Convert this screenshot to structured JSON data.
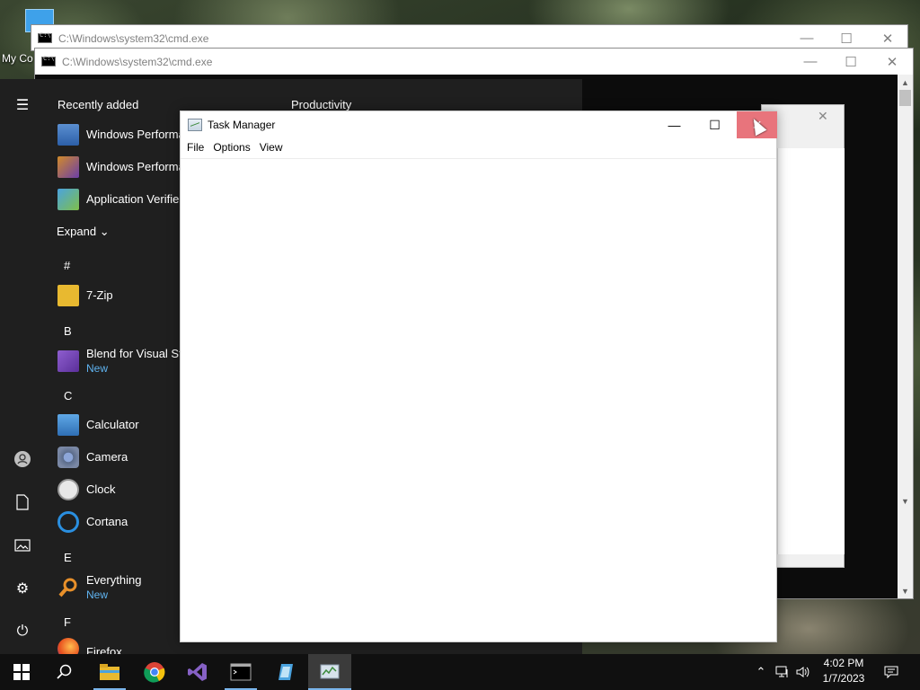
{
  "desktop": {
    "icon_label": "My Co"
  },
  "cmd_window_1": {
    "title": "C:\\Windows\\system32\\cmd.exe"
  },
  "cmd_window_2": {
    "title": "C:\\Windows\\system32\\cmd.exe"
  },
  "start_menu": {
    "recently_added_heading": "Recently added",
    "productivity_heading": "Productivity",
    "recent": [
      {
        "label": "Windows Performar",
        "icon": "performance-analyzer-icon"
      },
      {
        "label": "Windows Performar",
        "icon": "performance-recorder-icon"
      },
      {
        "label": "Application Verifier",
        "icon": "app-verifier-icon"
      }
    ],
    "expand_label": "Expand",
    "groups": [
      {
        "letter": "#",
        "apps": [
          {
            "label": "7-Zip",
            "sub": "",
            "icon": "folder-icon"
          }
        ]
      },
      {
        "letter": "B",
        "apps": [
          {
            "label": "Blend for Visual Stu",
            "sub": "New",
            "icon": "blend-icon"
          }
        ]
      },
      {
        "letter": "C",
        "apps": [
          {
            "label": "Calculator",
            "sub": "",
            "icon": "calculator-icon"
          },
          {
            "label": "Camera",
            "sub": "",
            "icon": "camera-icon"
          },
          {
            "label": "Clock",
            "sub": "",
            "icon": "clock-icon"
          },
          {
            "label": "Cortana",
            "sub": "",
            "icon": "cortana-icon"
          }
        ]
      },
      {
        "letter": "E",
        "apps": [
          {
            "label": "Everything",
            "sub": "New",
            "icon": "search-magnifier-icon"
          }
        ]
      },
      {
        "letter": "F",
        "apps": [
          {
            "label": "Firefox",
            "sub": "",
            "icon": "firefox-icon"
          }
        ]
      }
    ]
  },
  "task_manager": {
    "title": "Task Manager",
    "menu": [
      "File",
      "Options",
      "View"
    ]
  },
  "taskbar": {
    "clock_time": "4:02 PM",
    "clock_date": "1/7/2023"
  },
  "colors": {
    "accent": "#0078d7",
    "close_hover": "#e8747c",
    "start_bg": "#1f1f1f",
    "new_badge": "#5fb3f0"
  }
}
